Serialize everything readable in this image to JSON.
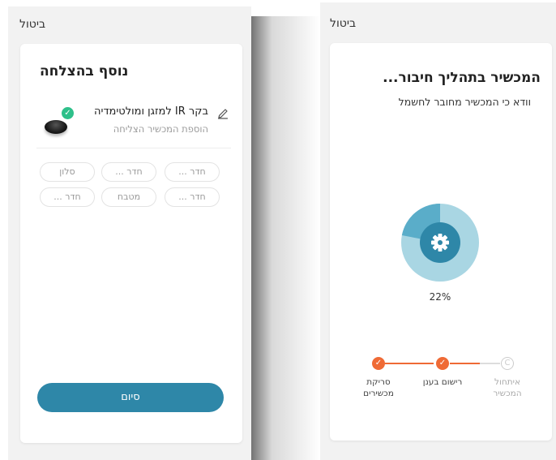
{
  "left": {
    "cancel_label": "ביטול",
    "title": "נוסף בהצלחה",
    "device": {
      "name": "בקר IR למזגן ומולטימדיה",
      "status": "הוספת המכשיר הצליחה"
    },
    "rooms": [
      "חדר ...",
      "חדר ...",
      "סלון",
      "חדר ...",
      "מטבח",
      "חדר ..."
    ],
    "finish_label": "סיום"
  },
  "right": {
    "cancel_label": "ביטול",
    "title": "המכשיר בתהליך חיבור...",
    "subtitle": "וודא כי המכשיר מחובר לחשמל",
    "progress_percent": 22,
    "progress_label": "22%",
    "steps": [
      {
        "label": "סריקת מכשירים",
        "status": "done"
      },
      {
        "label": "רישום בענן",
        "status": "done"
      },
      {
        "label": "איתחול המכשיר",
        "status": "pending"
      }
    ]
  },
  "colors": {
    "accent": "#2e87a8",
    "success": "#2ec08a",
    "step_done": "#ef6a35",
    "step_pending": "#cccccc"
  },
  "icons": [
    "edit-icon",
    "check-icon",
    "gear-icon"
  ]
}
